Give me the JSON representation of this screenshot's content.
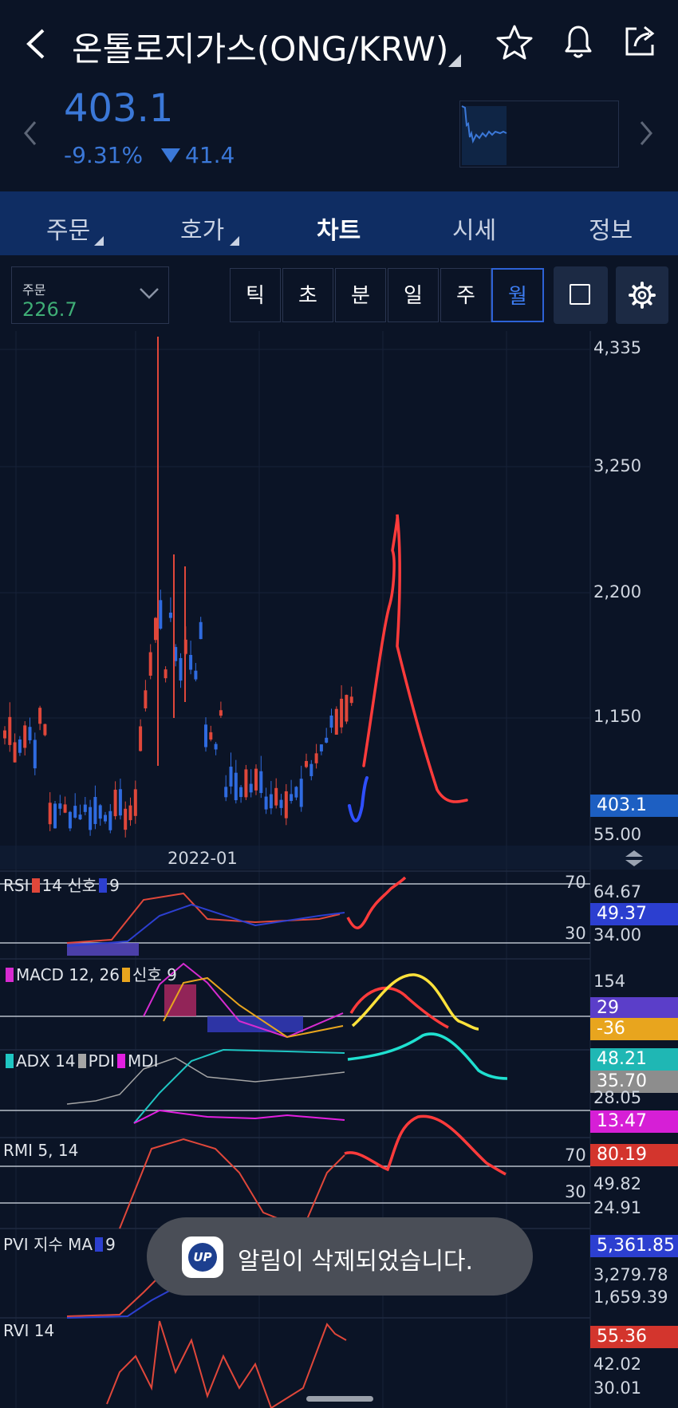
{
  "header": {
    "title": "온톨로지가스(ONG/KRW)",
    "icons": [
      "back-icon",
      "star-icon",
      "bell-icon",
      "share-icon"
    ]
  },
  "price": {
    "current": "403.1",
    "change_pct": "-9.31%",
    "change_amount": "41.4",
    "color": "#3b78d8"
  },
  "tabs": [
    {
      "label": "주문",
      "has_menu": true
    },
    {
      "label": "호가",
      "has_menu": true
    },
    {
      "label": "차트",
      "active": true
    },
    {
      "label": "시세"
    },
    {
      "label": "정보"
    }
  ],
  "toolbar": {
    "order_label": "주문",
    "order_value": "226.7",
    "periods": [
      "틱",
      "초",
      "분",
      "일",
      "주",
      "월"
    ],
    "active_period": "월"
  },
  "price_axis": {
    "ticks": [
      "4,335",
      "3,250",
      "2,200",
      "1,150",
      "55.00"
    ],
    "current_tag": "403.1",
    "date_label": "2022-01"
  },
  "indicators": {
    "rsi": {
      "name": "RSI",
      "param1": "14",
      "signal_label": "신호",
      "param2": "9",
      "levels": [
        "70",
        "30"
      ],
      "ticks": [
        "64.67",
        "34.00"
      ],
      "tag": "49.37"
    },
    "macd": {
      "name": "MACD 12, 26",
      "signal_label": "신호 9",
      "ticks": [
        "154"
      ],
      "tags": [
        "29",
        "-36"
      ]
    },
    "adx": {
      "name": "ADX 14",
      "pdi": "PDI",
      "mdi": "MDI",
      "ticks": [
        "28.05"
      ],
      "tags": [
        "48.21",
        "35.70",
        "13.47"
      ]
    },
    "rmi": {
      "name": "RMI 5, 14",
      "levels": [
        "70",
        "30"
      ],
      "ticks": [
        "49.82",
        "24.91"
      ],
      "tag": "80.19"
    },
    "pvi": {
      "name": "PVI 지수 MA",
      "param": "9",
      "ticks": [
        "3,279.78",
        "1,659.39"
      ],
      "tag": "5,361.85"
    },
    "rvi": {
      "name": "RVI 14",
      "ticks": [
        "42.02",
        "30.01"
      ],
      "tag": "55.36"
    }
  },
  "toast": {
    "logo_text": "UP",
    "message": "알림이 삭제되었습니다."
  },
  "colors": {
    "background": "#0b1426",
    "tab_bar": "#0f2d63",
    "up": "#e0473a",
    "down": "#2f6be0",
    "accent": "#3b78d8"
  }
}
